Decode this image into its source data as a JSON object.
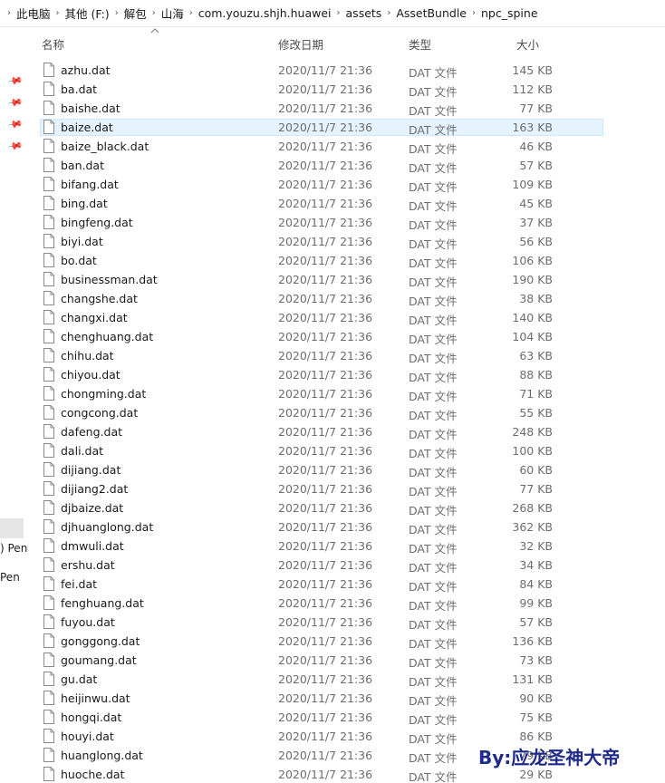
{
  "breadcrumb": [
    "此电脑",
    "其他 (F:)",
    "解包",
    "山海",
    "com.youzu.shjh.huawei",
    "assets",
    "AssetBundle",
    "npc_spine"
  ],
  "columns": {
    "name": "名称",
    "date": "修改日期",
    "type": "类型",
    "size": "大小"
  },
  "sidebar": {
    "label1": ") Pen",
    "label2": "Pen"
  },
  "files": [
    {
      "name": "azhu.dat",
      "date": "2020/11/7 21:36",
      "type": "DAT 文件",
      "size": "145 KB"
    },
    {
      "name": "ba.dat",
      "date": "2020/11/7 21:36",
      "type": "DAT 文件",
      "size": "112 KB"
    },
    {
      "name": "baishe.dat",
      "date": "2020/11/7 21:36",
      "type": "DAT 文件",
      "size": "77 KB"
    },
    {
      "name": "baize.dat",
      "date": "2020/11/7 21:36",
      "type": "DAT 文件",
      "size": "163 KB",
      "selected": true
    },
    {
      "name": "baize_black.dat",
      "date": "2020/11/7 21:36",
      "type": "DAT 文件",
      "size": "46 KB"
    },
    {
      "name": "ban.dat",
      "date": "2020/11/7 21:36",
      "type": "DAT 文件",
      "size": "57 KB"
    },
    {
      "name": "bifang.dat",
      "date": "2020/11/7 21:36",
      "type": "DAT 文件",
      "size": "109 KB"
    },
    {
      "name": "bing.dat",
      "date": "2020/11/7 21:36",
      "type": "DAT 文件",
      "size": "45 KB"
    },
    {
      "name": "bingfeng.dat",
      "date": "2020/11/7 21:36",
      "type": "DAT 文件",
      "size": "37 KB"
    },
    {
      "name": "biyi.dat",
      "date": "2020/11/7 21:36",
      "type": "DAT 文件",
      "size": "56 KB"
    },
    {
      "name": "bo.dat",
      "date": "2020/11/7 21:36",
      "type": "DAT 文件",
      "size": "106 KB"
    },
    {
      "name": "businessman.dat",
      "date": "2020/11/7 21:36",
      "type": "DAT 文件",
      "size": "190 KB"
    },
    {
      "name": "changshe.dat",
      "date": "2020/11/7 21:36",
      "type": "DAT 文件",
      "size": "38 KB"
    },
    {
      "name": "changxi.dat",
      "date": "2020/11/7 21:36",
      "type": "DAT 文件",
      "size": "140 KB"
    },
    {
      "name": "chenghuang.dat",
      "date": "2020/11/7 21:36",
      "type": "DAT 文件",
      "size": "104 KB"
    },
    {
      "name": "chihu.dat",
      "date": "2020/11/7 21:36",
      "type": "DAT 文件",
      "size": "63 KB"
    },
    {
      "name": "chiyou.dat",
      "date": "2020/11/7 21:36",
      "type": "DAT 文件",
      "size": "88 KB"
    },
    {
      "name": "chongming.dat",
      "date": "2020/11/7 21:36",
      "type": "DAT 文件",
      "size": "71 KB"
    },
    {
      "name": "congcong.dat",
      "date": "2020/11/7 21:36",
      "type": "DAT 文件",
      "size": "55 KB"
    },
    {
      "name": "dafeng.dat",
      "date": "2020/11/7 21:36",
      "type": "DAT 文件",
      "size": "248 KB"
    },
    {
      "name": "dali.dat",
      "date": "2020/11/7 21:36",
      "type": "DAT 文件",
      "size": "100 KB"
    },
    {
      "name": "dijiang.dat",
      "date": "2020/11/7 21:36",
      "type": "DAT 文件",
      "size": "60 KB"
    },
    {
      "name": "dijiang2.dat",
      "date": "2020/11/7 21:36",
      "type": "DAT 文件",
      "size": "77 KB"
    },
    {
      "name": "djbaize.dat",
      "date": "2020/11/7 21:36",
      "type": "DAT 文件",
      "size": "268 KB"
    },
    {
      "name": "djhuanglong.dat",
      "date": "2020/11/7 21:36",
      "type": "DAT 文件",
      "size": "362 KB"
    },
    {
      "name": "dmwuli.dat",
      "date": "2020/11/7 21:36",
      "type": "DAT 文件",
      "size": "32 KB"
    },
    {
      "name": "ershu.dat",
      "date": "2020/11/7 21:36",
      "type": "DAT 文件",
      "size": "34 KB"
    },
    {
      "name": "fei.dat",
      "date": "2020/11/7 21:36",
      "type": "DAT 文件",
      "size": "84 KB"
    },
    {
      "name": "fenghuang.dat",
      "date": "2020/11/7 21:36",
      "type": "DAT 文件",
      "size": "99 KB"
    },
    {
      "name": "fuyou.dat",
      "date": "2020/11/7 21:36",
      "type": "DAT 文件",
      "size": "57 KB"
    },
    {
      "name": "gonggong.dat",
      "date": "2020/11/7 21:36",
      "type": "DAT 文件",
      "size": "136 KB"
    },
    {
      "name": "goumang.dat",
      "date": "2020/11/7 21:36",
      "type": "DAT 文件",
      "size": "73 KB"
    },
    {
      "name": "gu.dat",
      "date": "2020/11/7 21:36",
      "type": "DAT 文件",
      "size": "131 KB"
    },
    {
      "name": "heijinwu.dat",
      "date": "2020/11/7 21:36",
      "type": "DAT 文件",
      "size": "90 KB"
    },
    {
      "name": "hongqi.dat",
      "date": "2020/11/7 21:36",
      "type": "DAT 文件",
      "size": "75 KB"
    },
    {
      "name": "houyi.dat",
      "date": "2020/11/7 21:36",
      "type": "DAT 文件",
      "size": "86 KB"
    },
    {
      "name": "huanglong.dat",
      "date": "2020/11/7 21:36",
      "type": "DAT 文件",
      "size": "79 KB"
    },
    {
      "name": "huoche.dat",
      "date": "2020/11/7 21:36",
      "type": "DAT 文件",
      "size": "29 KB"
    }
  ],
  "watermark": "By:应龙圣神大帝"
}
